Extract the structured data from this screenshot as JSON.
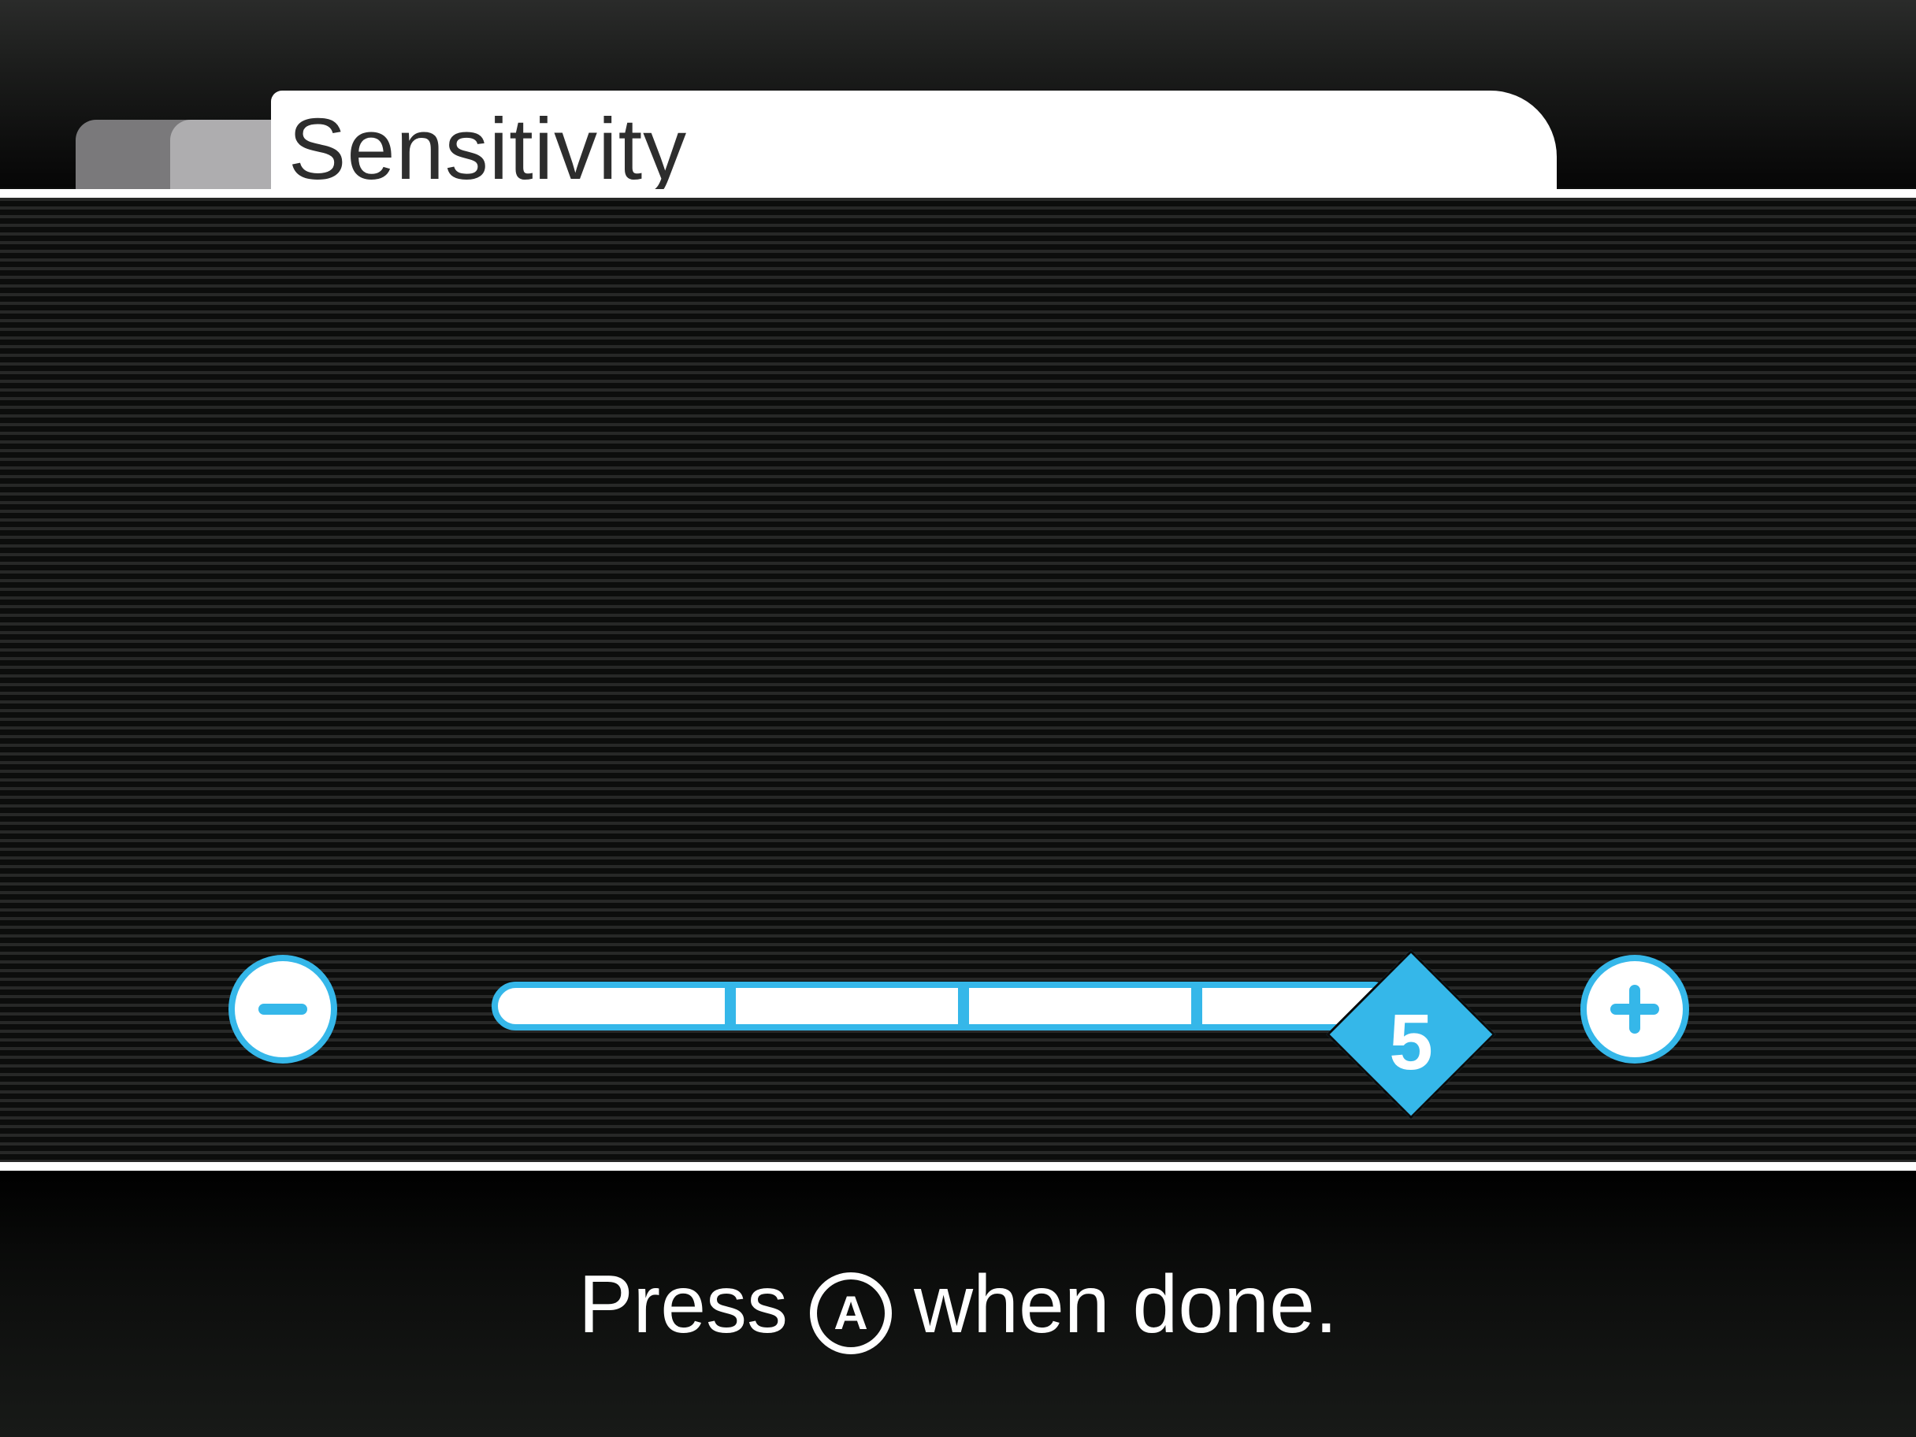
{
  "tabs": {
    "active_title": "Sensitivity"
  },
  "slider": {
    "value": "5",
    "min": 1,
    "max": 5,
    "steps": 5,
    "accent_color": "#35b7e9"
  },
  "footer": {
    "hint_before": "Press",
    "button_label": "A",
    "hint_after": "when done."
  },
  "icons": {
    "decrease": "minus-icon",
    "increase": "plus-icon",
    "confirm": "a-button-icon"
  }
}
